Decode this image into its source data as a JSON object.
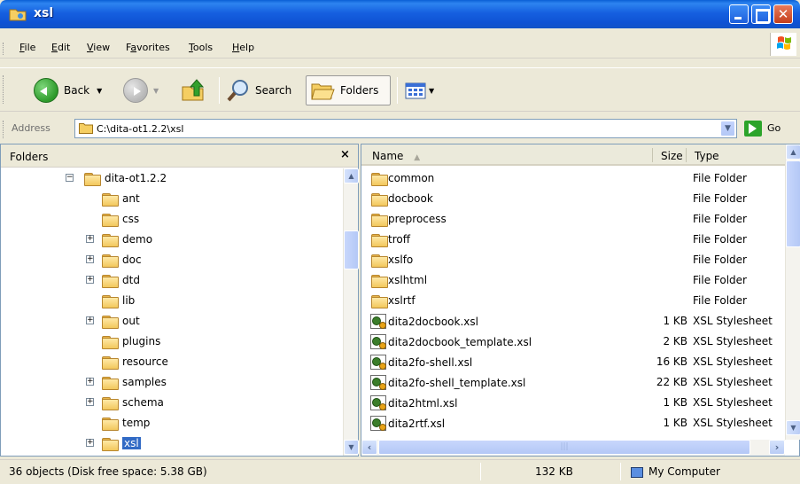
{
  "window": {
    "title": "xsl"
  },
  "menu": [
    {
      "label": "File",
      "key": "F",
      "rest": "ile"
    },
    {
      "label": "Edit",
      "key": "E",
      "rest": "dit"
    },
    {
      "label": "View",
      "key": "V",
      "rest": "iew"
    },
    {
      "label": "Favorites",
      "key": "a",
      "pre": "F",
      "rest": "vorites"
    },
    {
      "label": "Tools",
      "key": "T",
      "rest": "ools"
    },
    {
      "label": "Help",
      "key": "H",
      "rest": "elp"
    }
  ],
  "toolbar": {
    "back_label": "Back",
    "search_label": "Search",
    "folders_label": "Folders"
  },
  "address": {
    "label": "Address",
    "value": "C:\\dita-ot1.2.2\\xsl",
    "go_label": "Go"
  },
  "folders_pane": {
    "title": "Folders",
    "close_glyph": "×",
    "tree": [
      {
        "label": "dita-ot1.2.2",
        "expander": "⊟",
        "level": 0
      },
      {
        "label": "ant",
        "expander": "",
        "level": 1
      },
      {
        "label": "css",
        "expander": "",
        "level": 1
      },
      {
        "label": "demo",
        "expander": "+",
        "level": 1
      },
      {
        "label": "doc",
        "expander": "+",
        "level": 1
      },
      {
        "label": "dtd",
        "expander": "+",
        "level": 1
      },
      {
        "label": "lib",
        "expander": "",
        "level": 1
      },
      {
        "label": "out",
        "expander": "+",
        "level": 1
      },
      {
        "label": "plugins",
        "expander": "",
        "level": 1
      },
      {
        "label": "resource",
        "expander": "",
        "level": 1
      },
      {
        "label": "samples",
        "expander": "+",
        "level": 1
      },
      {
        "label": "schema",
        "expander": "+",
        "level": 1
      },
      {
        "label": "temp",
        "expander": "",
        "level": 1
      },
      {
        "label": "xsl",
        "expander": "+",
        "level": 1,
        "selected": true
      }
    ]
  },
  "file_list": {
    "columns": {
      "name": "Name",
      "size": "Size",
      "type": "Type"
    },
    "rows": [
      {
        "name": "common",
        "size": "",
        "type": "File Folder",
        "kind": "folder"
      },
      {
        "name": "docbook",
        "size": "",
        "type": "File Folder",
        "kind": "folder"
      },
      {
        "name": "preprocess",
        "size": "",
        "type": "File Folder",
        "kind": "folder"
      },
      {
        "name": "troff",
        "size": "",
        "type": "File Folder",
        "kind": "folder"
      },
      {
        "name": "xslfo",
        "size": "",
        "type": "File Folder",
        "kind": "folder"
      },
      {
        "name": "xslhtml",
        "size": "",
        "type": "File Folder",
        "kind": "folder"
      },
      {
        "name": "xslrtf",
        "size": "",
        "type": "File Folder",
        "kind": "folder"
      },
      {
        "name": "dita2docbook.xsl",
        "size": "1 KB",
        "type": "XSL Stylesheet",
        "kind": "xsl"
      },
      {
        "name": "dita2docbook_template.xsl",
        "size": "2 KB",
        "type": "XSL Stylesheet",
        "kind": "xsl"
      },
      {
        "name": "dita2fo-shell.xsl",
        "size": "16 KB",
        "type": "XSL Stylesheet",
        "kind": "xsl"
      },
      {
        "name": "dita2fo-shell_template.xsl",
        "size": "22 KB",
        "type": "XSL Stylesheet",
        "kind": "xsl"
      },
      {
        "name": "dita2html.xsl",
        "size": "1 KB",
        "type": "XSL Stylesheet",
        "kind": "xsl"
      },
      {
        "name": "dita2rtf.xsl",
        "size": "1 KB",
        "type": "XSL Stylesheet",
        "kind": "xsl"
      }
    ]
  },
  "status": {
    "objects": "36 objects (Disk free space: 5.38 GB)",
    "size": "132 KB",
    "location": "My Computer"
  },
  "colors": {
    "titlebar": "#0E52D4",
    "selection": "#316AC5",
    "window_bg": "#ECE9D8"
  }
}
